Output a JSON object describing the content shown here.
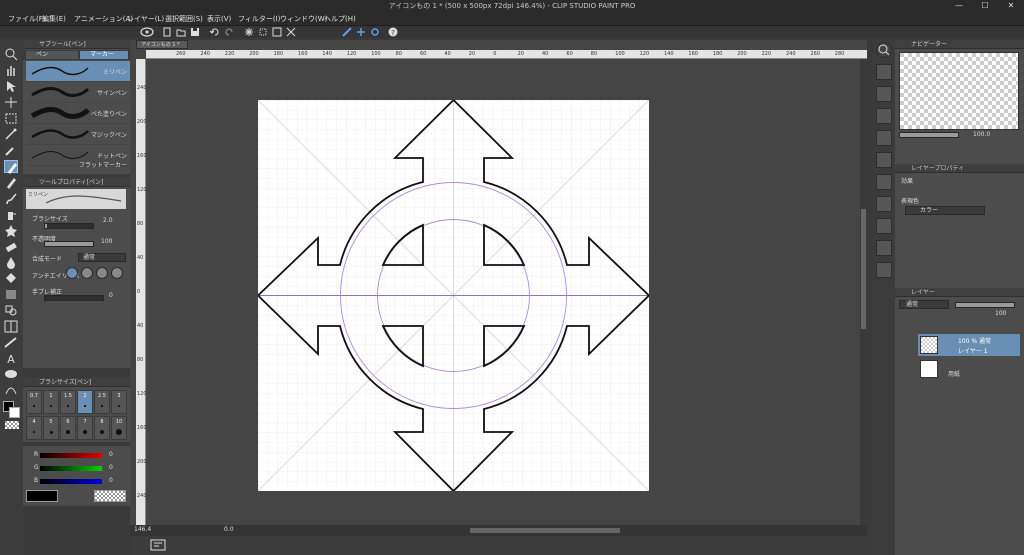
{
  "window": {
    "title": "アイコンもの 1 * (500 x 500px 72dpi 146.4%)  - CLIP STUDIO PAINT PRO",
    "min_glyph": "—",
    "max_glyph": "☐",
    "close_glyph": "✕"
  },
  "menu": [
    "ファイル(F)",
    "編集(E)",
    "アニメーション(A)",
    "レイヤー(L)",
    "選択範囲(S)",
    "表示(V)",
    "フィルター(I)",
    "ウィンドウ(W)",
    "ヘルプ(H)"
  ],
  "document_tab": "アイコンもの 1 *",
  "tool_property_header": "ツールプロパティ[ペン]",
  "sub_tool": {
    "header": "サブツール[ペン]",
    "tabs": [
      "ペン",
      "マーカー"
    ],
    "brushes": [
      "ミリペン",
      "サインペン",
      "べた塗りペン",
      "マジックペン",
      "ドットペン",
      "フラットマーカー"
    ],
    "selected_index": 0
  },
  "tool_property": {
    "brush_name": "ミリペン",
    "brush_size_label": "ブラシサイズ",
    "brush_size_value": "2.0",
    "brush_size_fraction": 0.04,
    "opacity_label": "不透明度",
    "opacity_value": "100",
    "opacity_fraction": 1.0,
    "blend_label": "合成モード",
    "blend_value": "通常",
    "antialias_label": "アンチエイリアス",
    "stabilize_label": "手ブレ補正",
    "stabilize_value": "0"
  },
  "brush_size_palette": {
    "header": "ブラシサイズ[ペン]",
    "row1": [
      "0.7",
      "1",
      "1.5",
      "2",
      "2.5",
      "3"
    ],
    "row2": [
      "4",
      "5",
      "6",
      "7",
      "8",
      "10"
    ],
    "selected": "2"
  },
  "color_slider": {
    "labels": [
      "R",
      "G",
      "B"
    ],
    "values": [
      "0",
      "0",
      "0"
    ]
  },
  "ruler": {
    "top": [
      "260",
      "240",
      "220",
      "200",
      "180",
      "160",
      "140",
      "120",
      "100",
      "80",
      "60",
      "40",
      "20",
      "0",
      "20",
      "40",
      "60",
      "80",
      "100",
      "120",
      "140",
      "160",
      "180",
      "200",
      "220",
      "240",
      "260",
      "280"
    ],
    "left": [
      "240",
      "200",
      "160",
      "120",
      "80",
      "40",
      "0",
      "40",
      "80",
      "120",
      "160",
      "200",
      "240"
    ]
  },
  "status": {
    "zoom": "146.4",
    "angle": "0.0"
  },
  "navigator_header": "ナビゲーター",
  "navigator_value": "100.0",
  "layer_property": {
    "header": "レイヤープロパティ",
    "effect_label": "効果",
    "color_label": "表現色",
    "color_value": "カラー"
  },
  "layer_panel": {
    "header": "レイヤー",
    "blend": "通常",
    "opacity": "100",
    "layers": [
      {
        "info": "100 % 通常",
        "name": "レイヤー 1"
      },
      {
        "info": "",
        "name": "用紙"
      }
    ]
  },
  "colors": {
    "accent": "#6a8fb5",
    "guide_purple": "#b18ad6",
    "panel_bg": "#4c4c4c",
    "canvas_bg": "#454545"
  }
}
